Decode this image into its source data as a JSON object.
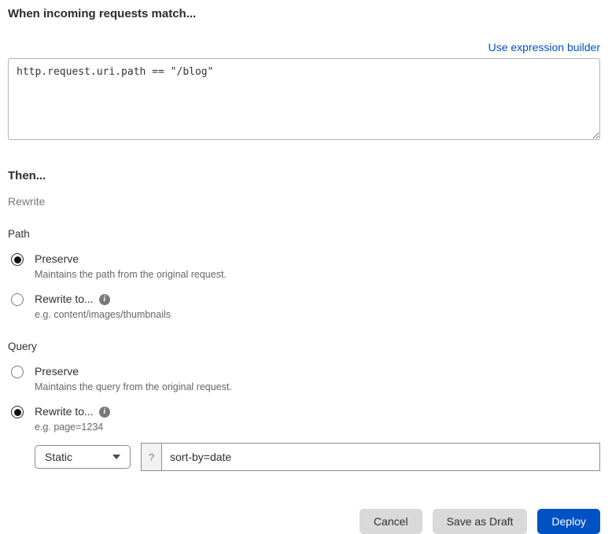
{
  "match": {
    "heading": "When incoming requests match...",
    "expression_builder_link": "Use expression builder",
    "expression_value": "http.request.uri.path == \"/blog\""
  },
  "then": {
    "heading": "Then...",
    "action_label": "Rewrite"
  },
  "path_section": {
    "label": "Path",
    "options": [
      {
        "label": "Preserve",
        "description": "Maintains the path from the original request.",
        "selected": true
      },
      {
        "label": "Rewrite to...",
        "description": "e.g. content/images/thumbnails",
        "selected": false,
        "info_icon": "i"
      }
    ]
  },
  "query_section": {
    "label": "Query",
    "options": [
      {
        "label": "Preserve",
        "description": "Maintains the query from the original request.",
        "selected": false
      },
      {
        "label": "Rewrite to...",
        "description": "e.g. page=1234",
        "selected": true,
        "info_icon": "i"
      }
    ],
    "rewrite_input": {
      "type_selected": "Static",
      "prefix": "?",
      "value": "sort-by=date"
    }
  },
  "footer": {
    "cancel_label": "Cancel",
    "save_draft_label": "Save as Draft",
    "deploy_label": "Deploy"
  },
  "colors": {
    "accent_blue": "#0051c3",
    "link_blue": "#0051c3",
    "button_gray": "#d9d9d9",
    "border_gray": "#8c8c8c",
    "info_icon_gray": "#797979"
  }
}
